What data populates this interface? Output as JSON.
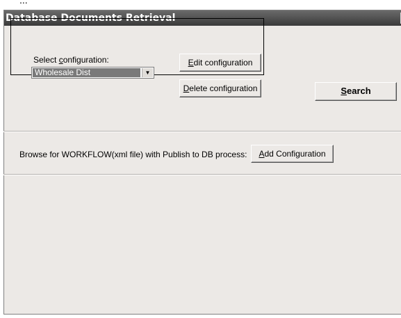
{
  "window": {
    "title": "Database Documents Retrieval"
  },
  "config": {
    "select_label_pre": "Select ",
    "select_label_key": "c",
    "select_label_post": "onfiguration:",
    "selected_value": "Wholesale Dist",
    "edit_key": "E",
    "edit_rest": "dit configuration",
    "delete_key": "D",
    "delete_rest": "elete configuration"
  },
  "search": {
    "key": "S",
    "rest": "earch"
  },
  "browse": {
    "label": "Browse for WORKFLOW(xml file) with Publish to DB process:",
    "add_key": "A",
    "add_rest": "dd Configuration"
  },
  "colors": {
    "titlebar": "#4a4a4a",
    "window_bg": "#ece9e6",
    "selection": "#7a7a7a"
  }
}
